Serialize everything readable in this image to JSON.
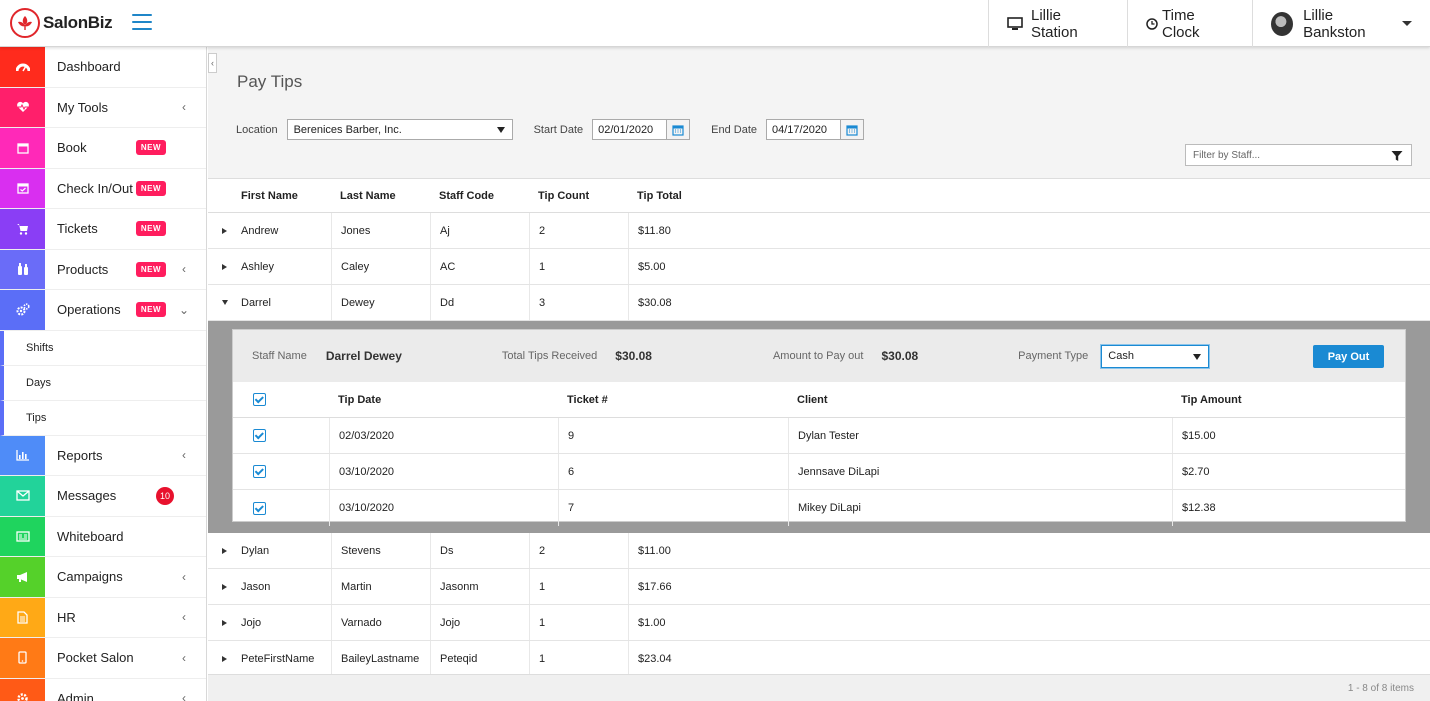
{
  "app": {
    "brand": "SalonBiz",
    "station": "Lillie Station",
    "time_clock": "Time Clock",
    "user_name": "Lillie Bankston"
  },
  "sidebar": {
    "items": [
      {
        "label": "Dashboard",
        "icon": "dashboard-icon",
        "color": "#ff2b1d"
      },
      {
        "label": "My Tools",
        "icon": "heartbeat-icon",
        "color": "#ff1f6b",
        "chevron": "‹"
      },
      {
        "label": "Book",
        "icon": "calendar-icon",
        "color": "#ff29b8",
        "badge": "NEW"
      },
      {
        "label": "Check In/Out",
        "icon": "calendar-check-icon",
        "color": "#d92ff0",
        "badge": "NEW"
      },
      {
        "label": "Tickets",
        "icon": "cart-icon",
        "color": "#8a3ef5",
        "badge": "NEW"
      },
      {
        "label": "Products",
        "icon": "bottles-icon",
        "color": "#6a6cf8",
        "badge": "NEW",
        "chevron": "‹"
      },
      {
        "label": "Operations",
        "icon": "gears-icon",
        "color": "#5b6ef7",
        "badge": "NEW",
        "chevron": "⌄"
      }
    ],
    "sub_items": [
      "Shifts",
      "Days",
      "Tips"
    ],
    "items_after": [
      {
        "label": "Reports",
        "icon": "bar-chart-icon",
        "color": "#4f8cf8",
        "chevron": "‹"
      },
      {
        "label": "Messages",
        "icon": "envelope-icon",
        "color": "#22d39a",
        "count": "10"
      },
      {
        "label": "Whiteboard",
        "icon": "whiteboard-icon",
        "color": "#1fd45e"
      },
      {
        "label": "Campaigns",
        "icon": "megaphone-icon",
        "color": "#55d12a",
        "chevron": "‹"
      },
      {
        "label": "HR",
        "icon": "document-icon",
        "color": "#ffa916",
        "chevron": "‹"
      },
      {
        "label": "Pocket Salon",
        "icon": "mobile-icon",
        "color": "#ff7a16",
        "chevron": "‹"
      },
      {
        "label": "Admin",
        "icon": "gear-icon",
        "color": "#ff5a16",
        "chevron": "‹"
      }
    ]
  },
  "page": {
    "title": "Pay Tips",
    "location_label": "Location",
    "location_value": "Berenices Barber, Inc.",
    "start_label": "Start Date",
    "start_value": "02/01/2020",
    "end_label": "End Date",
    "end_value": "04/17/2020",
    "staff_filter_placeholder": "Filter by Staff..."
  },
  "grid": {
    "columns": [
      "First Name",
      "Last Name",
      "Staff Code",
      "Tip Count",
      "Tip Total"
    ],
    "rows_before": [
      {
        "first": "Andrew",
        "last": "Jones",
        "code": "Aj",
        "count": "2",
        "total": "$11.80"
      },
      {
        "first": "Ashley",
        "last": "Caley",
        "code": "AC",
        "count": "1",
        "total": "$5.00"
      },
      {
        "first": "Darrel",
        "last": "Dewey",
        "code": "Dd",
        "count": "3",
        "total": "$30.08"
      }
    ],
    "rows_after": [
      {
        "first": "Dylan",
        "last": "Stevens",
        "code": "Ds",
        "count": "2",
        "total": "$11.00"
      },
      {
        "first": "Jason",
        "last": "Martin",
        "code": "Jasonm",
        "count": "1",
        "total": "$17.66"
      },
      {
        "first": "Jojo",
        "last": "Varnado",
        "code": "Jojo",
        "count": "1",
        "total": "$1.00"
      },
      {
        "first": "PeteFirstName",
        "last": "BaileyLastname",
        "code": "Peteqid",
        "count": "1",
        "total": "$23.04"
      }
    ],
    "pager": "1 - 8 of 8 items"
  },
  "detail": {
    "staff_name_label": "Staff Name",
    "staff_name": "Darrel Dewey",
    "total_label": "Total Tips Received",
    "total_value": "$30.08",
    "payout_label": "Amount to Pay out",
    "payout_value": "$30.08",
    "payment_type_label": "Payment Type",
    "payment_type_value": "Cash",
    "pay_out_button": "Pay Out",
    "columns": [
      "Tip Date",
      "Ticket #",
      "Client",
      "Tip Amount"
    ],
    "rows": [
      {
        "date": "02/03/2020",
        "ticket": "9",
        "client": "Dylan Tester",
        "amount": "$15.00"
      },
      {
        "date": "03/10/2020",
        "ticket": "6",
        "client": "Jennsave DiLapi",
        "amount": "$2.70"
      },
      {
        "date": "03/10/2020",
        "ticket": "7",
        "client": "Mikey DiLapi",
        "amount": "$12.38"
      }
    ]
  }
}
